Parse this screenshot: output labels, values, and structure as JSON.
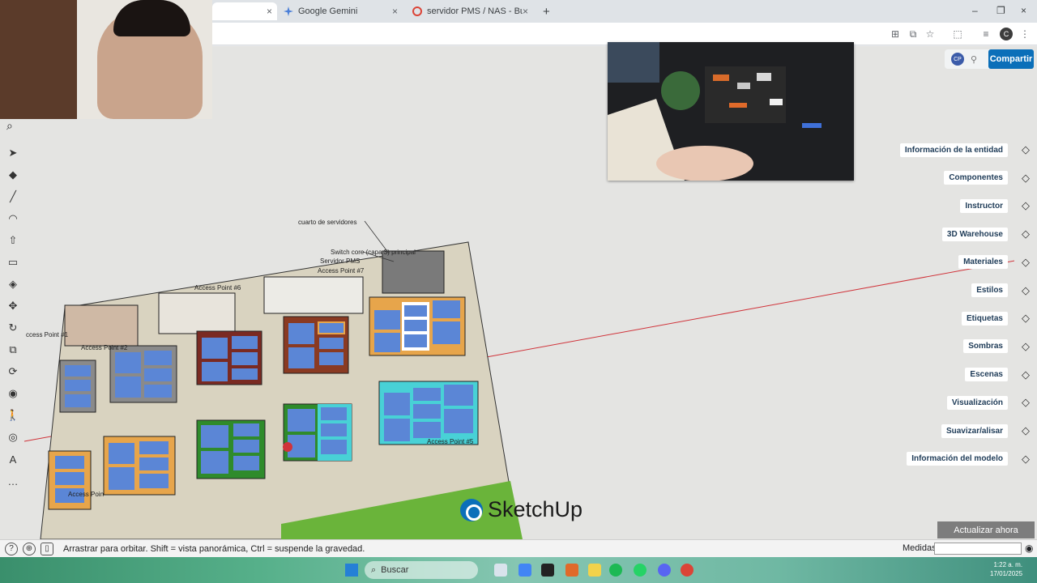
{
  "browser": {
    "tabs": [
      {
        "label": "",
        "active": true
      },
      {
        "label": "Google Gemini",
        "active": false
      },
      {
        "label": "servidor PMS / NAS - Buscar co",
        "active": false
      }
    ],
    "new_tab": "+",
    "close": "×",
    "window_controls": {
      "minimize": "–",
      "restore": "❐",
      "close": "×"
    },
    "profile_initial": "C"
  },
  "app": {
    "share_button": "Compartir",
    "collaborator_initials": "CP",
    "update_button": "Actualizar ahora",
    "watermark": "SketchUp",
    "right_panel": [
      {
        "label": "Información de la entidad",
        "icon": "info-cube-icon"
      },
      {
        "label": "Componentes",
        "icon": "components-icon"
      },
      {
        "label": "Instructor",
        "icon": "instructor-icon"
      },
      {
        "label": "3D Warehouse",
        "icon": "warehouse-icon"
      },
      {
        "label": "Materiales",
        "icon": "materials-icon"
      },
      {
        "label": "Estilos",
        "icon": "styles-icon"
      },
      {
        "label": "Etiquetas",
        "icon": "tags-icon"
      },
      {
        "label": "Sombras",
        "icon": "shadows-icon"
      },
      {
        "label": "Escenas",
        "icon": "scenes-icon"
      },
      {
        "label": "Visualización",
        "icon": "display-icon"
      },
      {
        "label": "Suavizar/alisar",
        "icon": "soften-icon"
      },
      {
        "label": "Información del modelo",
        "icon": "model-info-icon"
      }
    ],
    "left_tools": [
      {
        "name": "select-tool",
        "glyph": "➤"
      },
      {
        "name": "eraser-tool",
        "glyph": "◆"
      },
      {
        "name": "line-tool",
        "glyph": "╱"
      },
      {
        "name": "arc-tool",
        "glyph": "◠"
      },
      {
        "name": "pushpull-tool",
        "glyph": "⇧"
      },
      {
        "name": "rectangle-tool",
        "glyph": "▭"
      },
      {
        "name": "paint-bucket-tool",
        "glyph": "◈"
      },
      {
        "name": "move-tool",
        "glyph": "✥"
      },
      {
        "name": "rotate-tool",
        "glyph": "↻"
      },
      {
        "name": "scale-tool",
        "glyph": "⧉"
      },
      {
        "name": "orbit-tool",
        "glyph": "⟳"
      },
      {
        "name": "tape-tool",
        "glyph": "◉"
      },
      {
        "name": "walk-tool",
        "glyph": "🚶"
      },
      {
        "name": "look-around-tool",
        "glyph": "◎"
      },
      {
        "name": "text-tool",
        "glyph": "A"
      },
      {
        "name": "more-tools",
        "glyph": "…"
      }
    ],
    "model_labels": {
      "server_room": "cuarto de servidores",
      "switch_core": "Switch core (capa 3) principal",
      "servidor_pms": "Servidor PMS",
      "ap7": "Access Point #7",
      "ap6": "Access Point #6",
      "ap1": "ccess Point #1",
      "ap2": "Access Point #2",
      "ap5": "Access Point #5",
      "ap_bottom": "Access Poin"
    }
  },
  "status_bar": {
    "hint": "Arrastrar para orbitar. Shift = vista panorámica, Ctrl = suspende la gravedad.",
    "measurements_label": "Medidas",
    "measurements_value": ""
  },
  "taskbar": {
    "search_placeholder": "Buscar",
    "time": "1:22 a. m.",
    "date": "17/01/2025"
  },
  "colors": {
    "accent": "#0b6fb9",
    "axis_red": "#d0333a",
    "floor": "#d9d3c0",
    "grass": "#6ab43a",
    "window_blue": "#5b86d6"
  }
}
